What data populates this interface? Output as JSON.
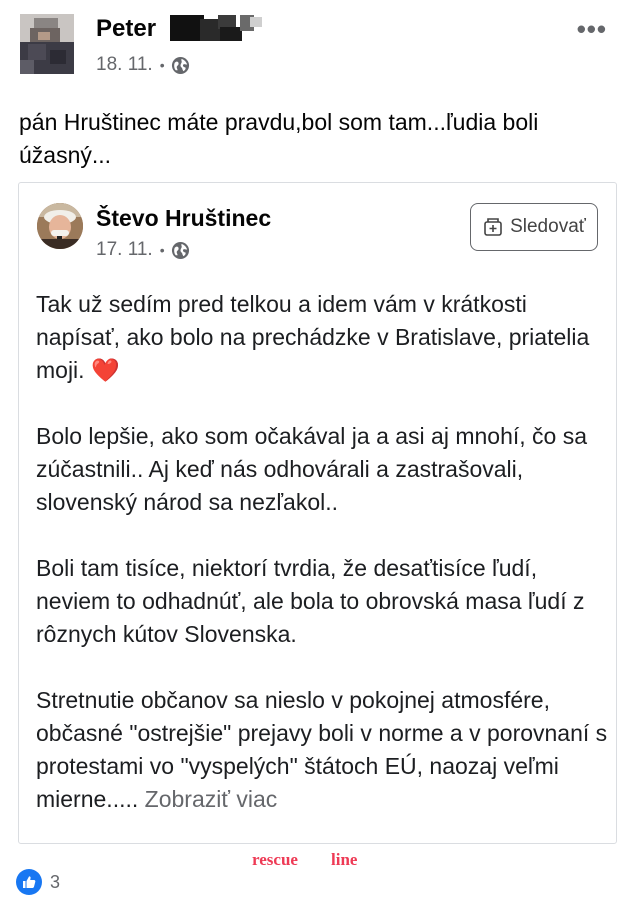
{
  "post": {
    "author": "Peter",
    "date": "18. 11.",
    "text": "pán Hruštinec máte pravdu,bol som tam...ľudia boli úžasný...",
    "reaction_count": "3"
  },
  "shared_post": {
    "author": "Števo Hruštinec",
    "date": "17. 11.",
    "follow_label": "Sledovať",
    "paragraphs": {
      "p1": "Tak už sedím pred telkou a idem vám v krátkosti napísať, ako bolo na prechádzke v Bratislave, priatelia moji.",
      "p1_emoji": "❤️",
      "p2": "Bolo lepšie, ako som očakával ja a asi aj mnohí, čo sa zúčastnili.. Aj keď nás odhovárali a zastrašovali, slovenský národ sa nezľakol..",
      "p3": "Boli tam tisíce, niektorí tvrdia, že desaťtisíce ľudí, neviem to odhadnúť, ale bola to obrovská masa ľudí z rôznych kútov Slovenska.",
      "p4": "Stretnutie občanov sa nieslo v pokojnej atmosfére, občasné \"ostrejšie\" prejavy boli v norme a v porovnaní s protestami vo \"vyspelých\" štátoch EÚ, naozaj veľmi mierne....."
    },
    "see_more": "Zobraziť viac"
  },
  "watermark": {
    "word1": "rescue",
    "word2": "line"
  },
  "icons": {
    "privacy": "globe-icon",
    "menu": "more-options-icon",
    "follow": "follow-icon",
    "reaction": "like-icon"
  },
  "colors": {
    "like_blue": "#1877f2",
    "meta_gray": "#65676b",
    "watermark_red": "#ee3a55"
  }
}
